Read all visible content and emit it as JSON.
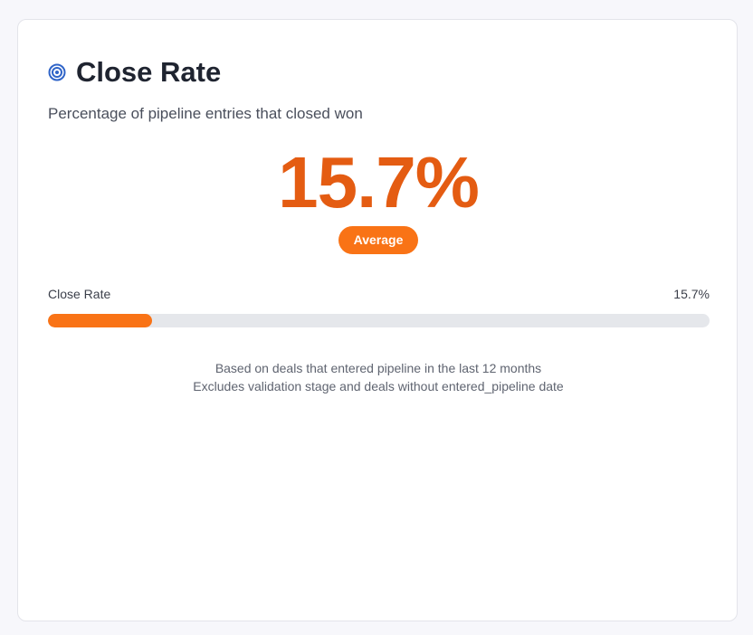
{
  "card": {
    "icon": "target-icon",
    "title": "Close Rate",
    "subtitle": "Percentage of pipeline entries that closed won",
    "value": "15.7%",
    "badge": "Average",
    "progress": {
      "label": "Close Rate",
      "value_text": "15.7%",
      "percent": 15.7
    },
    "notes": [
      "Based on deals that entered pipeline in the last 12 months",
      "Excludes validation stage and deals without entered_pipeline date"
    ]
  },
  "colors": {
    "accent": "#f97316",
    "value": "#e45c12",
    "icon": "#2f64c8"
  }
}
